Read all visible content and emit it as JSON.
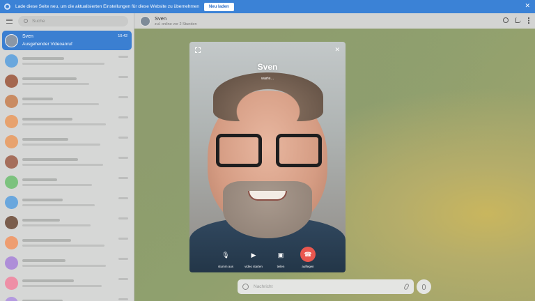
{
  "banner": {
    "message": "Lade diese Seite neu, um die aktualisierten Einstellungen für diese Website zu übernehmen",
    "button": "Neu laden",
    "close": "✕"
  },
  "sidebar": {
    "search_placeholder": "Suche",
    "active_chat": {
      "name": "Sven",
      "time": "10:42",
      "subtitle": "Ausgehender Videoanruf"
    },
    "chat_avatar_colors": [
      "#6aa7dd",
      "#a4674f",
      "#c98b62",
      "#e7a26e",
      "#e7a26e",
      "#a56e5b",
      "#7cc27e",
      "#6aa7dd",
      "#7a5d4c",
      "#ee9d70",
      "#ae8ed8",
      "#ee8fa6",
      "#b49adf"
    ]
  },
  "chat_header": {
    "name": "Sven",
    "status": "zul. online vor 2 Stunden"
  },
  "call": {
    "name": "Sven",
    "status": "warte...",
    "controls": [
      {
        "icon": "microphone-icon",
        "label": "stumm aus"
      },
      {
        "icon": "camera-icon",
        "label": "video starten"
      },
      {
        "icon": "screen-share-icon",
        "label": "teilen"
      },
      {
        "icon": "hang-up-icon",
        "label": "auflegen"
      }
    ]
  },
  "composer": {
    "placeholder": "Nachricht"
  },
  "colors": {
    "accent": "#3b7fd1",
    "end_call": "#e9574f"
  }
}
